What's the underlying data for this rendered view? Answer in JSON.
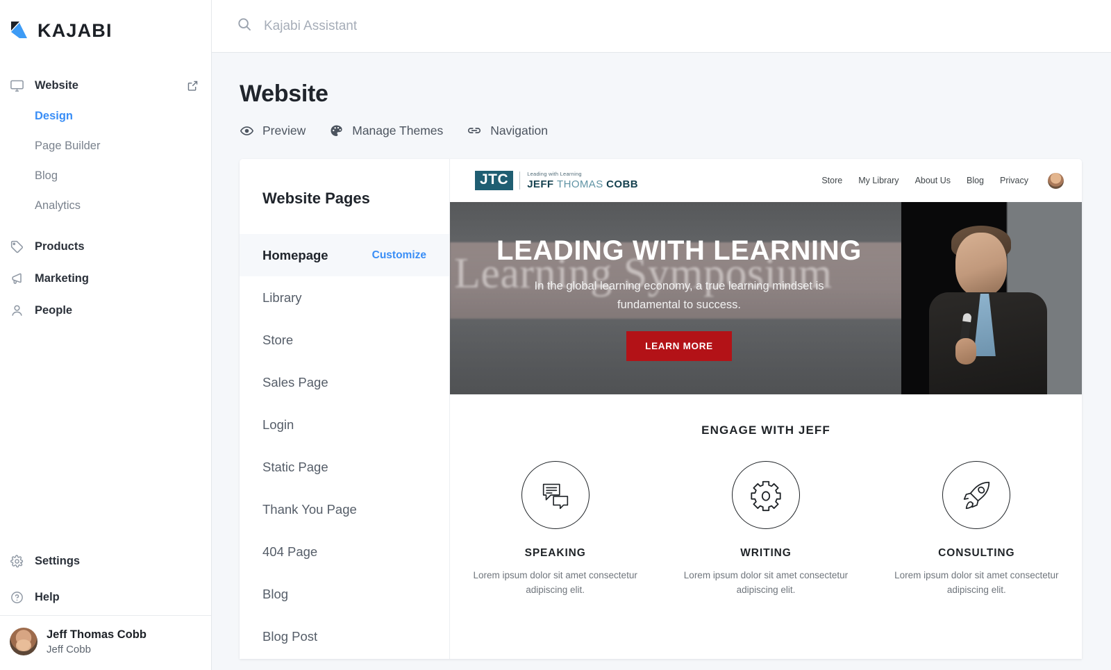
{
  "brand": {
    "name": "KAJABI",
    "logo_icon": "kajabi-k-logo"
  },
  "sidebar": {
    "primary": [
      {
        "label": "Website",
        "icon": "monitor-icon",
        "external_icon": "external-link-icon",
        "active": true
      },
      {
        "label": "Products",
        "icon": "tag-icon"
      },
      {
        "label": "Marketing",
        "icon": "megaphone-icon"
      },
      {
        "label": "People",
        "icon": "person-icon"
      }
    ],
    "website_subitems": [
      {
        "label": "Design",
        "active": true
      },
      {
        "label": "Page Builder",
        "active": false
      },
      {
        "label": "Blog",
        "active": false
      },
      {
        "label": "Analytics",
        "active": false
      }
    ],
    "footer": [
      {
        "label": "Settings",
        "icon": "gear-icon"
      },
      {
        "label": "Help",
        "icon": "question-circle-icon"
      }
    ],
    "user": {
      "name": "Jeff Thomas Cobb",
      "site": "Jeff Cobb",
      "avatar": "user-avatar"
    }
  },
  "topbar": {
    "search_placeholder": "Kajabi Assistant",
    "search_value": "",
    "search_icon": "search-icon"
  },
  "header": {
    "title": "Website",
    "actions": [
      {
        "label": "Preview",
        "icon": "eye-icon"
      },
      {
        "label": "Manage Themes",
        "icon": "palette-icon"
      },
      {
        "label": "Navigation",
        "icon": "link-icon"
      }
    ]
  },
  "pages_panel": {
    "title": "Website Pages",
    "customize_label": "Customize",
    "items": [
      {
        "label": "Homepage",
        "active": true,
        "has_customize": true
      },
      {
        "label": "Library",
        "active": false,
        "has_customize": false
      },
      {
        "label": "Store",
        "active": false,
        "has_customize": false
      },
      {
        "label": "Sales Page",
        "active": false,
        "has_customize": false
      },
      {
        "label": "Login",
        "active": false,
        "has_customize": false
      },
      {
        "label": "Static Page",
        "active": false,
        "has_customize": false
      },
      {
        "label": "Thank You Page",
        "active": false,
        "has_customize": false
      },
      {
        "label": "404 Page",
        "active": false,
        "has_customize": false
      },
      {
        "label": "Blog",
        "active": false,
        "has_customize": false
      },
      {
        "label": "Blog Post",
        "active": false,
        "has_customize": false
      }
    ]
  },
  "preview": {
    "site_logo": {
      "mark": "JTC",
      "tagline": "Leading with Learning",
      "name_dark_1": "JEFF ",
      "name_light": "THOMAS ",
      "name_dark_2": "COBB"
    },
    "site_nav": [
      {
        "label": "Store"
      },
      {
        "label": "My Library"
      },
      {
        "label": "About Us"
      },
      {
        "label": "Blog"
      },
      {
        "label": "Privacy"
      }
    ],
    "site_avatar": "site-user-avatar",
    "hero": {
      "background_text": "Learning Symposium",
      "title": "LEADING WITH LEARNING",
      "subtitle": "In the global learning economy, a true learning mindset is fundamental to success.",
      "button": "LEARN MORE",
      "button_color": "#b31217"
    },
    "engage": {
      "title": "ENGAGE WITH JEFF",
      "columns": [
        {
          "title": "SPEAKING",
          "icon": "chat-bubbles-icon",
          "desc": "Lorem ipsum dolor sit amet consectetur adipiscing elit."
        },
        {
          "title": "WRITING",
          "icon": "gear-icon",
          "desc": "Lorem ipsum dolor sit amet consectetur adipiscing elit."
        },
        {
          "title": "CONSULTING",
          "icon": "rocket-icon",
          "desc": "Lorem ipsum dolor sit amet consectetur adipiscing elit."
        }
      ]
    }
  },
  "colors": {
    "accent_blue": "#3a8ef6",
    "brand_teal": "#1f5e72",
    "hero_red": "#b31217",
    "page_bg": "#f5f7fa"
  }
}
